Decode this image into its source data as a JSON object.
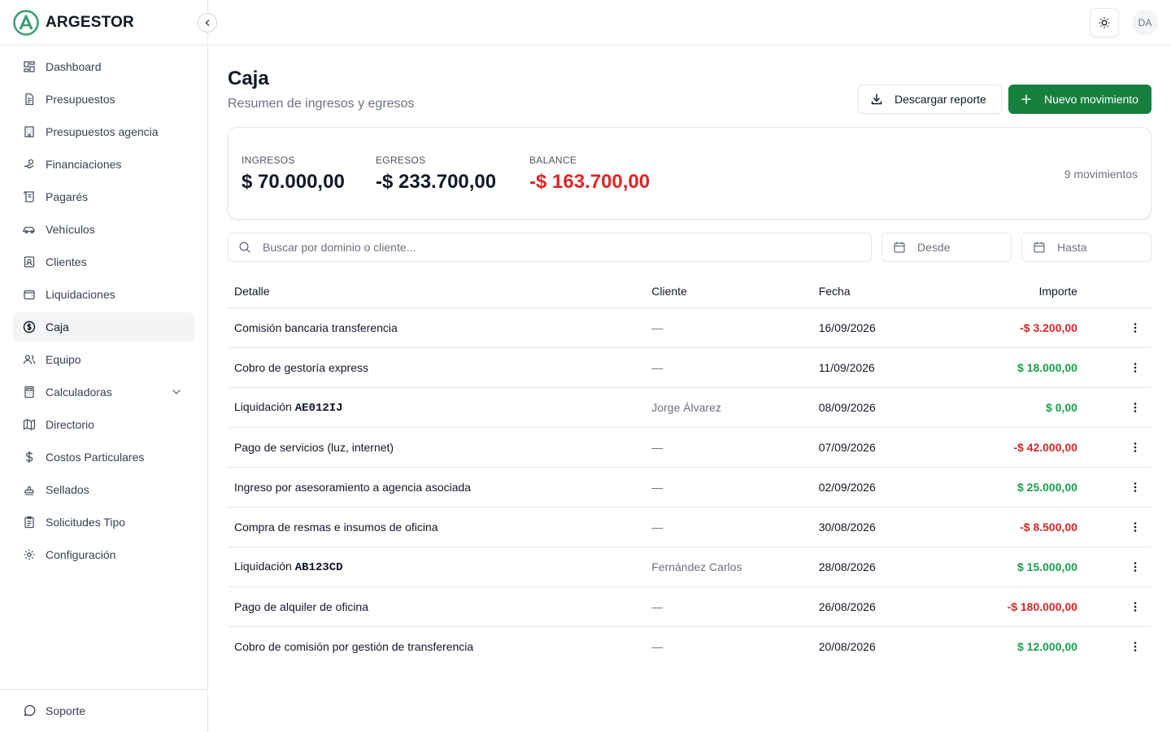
{
  "brand": {
    "name": "ARGESTOR",
    "accent": "#15803d"
  },
  "sidebar": {
    "items": [
      {
        "label": "Dashboard",
        "icon": "layout-dashboard-icon"
      },
      {
        "label": "Presupuestos",
        "icon": "file-text-icon"
      },
      {
        "label": "Presupuestos agencia",
        "icon": "building-icon"
      },
      {
        "label": "Financiaciones",
        "icon": "hand-coins-icon"
      },
      {
        "label": "Pagarés",
        "icon": "scroll-icon"
      },
      {
        "label": "Vehículos",
        "icon": "car-icon"
      },
      {
        "label": "Clientes",
        "icon": "contact-icon"
      },
      {
        "label": "Liquidaciones",
        "icon": "wallet-icon"
      },
      {
        "label": "Caja",
        "icon": "dollar-circle-icon",
        "active": true
      },
      {
        "label": "Equipo",
        "icon": "users-icon"
      },
      {
        "label": "Calculadoras",
        "icon": "calculator-icon",
        "expandable": true
      },
      {
        "label": "Directorio",
        "icon": "map-icon"
      },
      {
        "label": "Costos Particulares",
        "icon": "dollar-sign-icon"
      },
      {
        "label": "Sellados",
        "icon": "stamp-icon"
      },
      {
        "label": "Solicitudes Tipo",
        "icon": "clipboard-icon"
      },
      {
        "label": "Configuración",
        "icon": "settings-icon"
      }
    ],
    "footer_label": "Soporte"
  },
  "topbar": {
    "avatar_initials": "DA"
  },
  "page": {
    "title": "Caja",
    "subtitle": "Resumen de ingresos y egresos",
    "download_label": "Descargar reporte",
    "new_label": "Nuevo movimiento"
  },
  "summary": {
    "ingresos_label": "INGRESOS",
    "ingresos_value": "$ 70.000,00",
    "egresos_label": "EGRESOS",
    "egresos_value": "-$ 233.700,00",
    "balance_label": "BALANCE",
    "balance_value": "-$ 163.700,00",
    "count_label": "9 movimientos"
  },
  "filters": {
    "search_placeholder": "Buscar por dominio o cliente...",
    "desde_placeholder": "Desde",
    "hasta_placeholder": "Hasta"
  },
  "table": {
    "headers": {
      "detalle": "Detalle",
      "cliente": "Cliente",
      "fecha": "Fecha",
      "importe": "Importe"
    },
    "rows": [
      {
        "detalle": "Comisión bancaria transferencia",
        "dominio": "",
        "cliente": "—",
        "fecha": "16/09/2026",
        "importe": "-$ 3.200,00",
        "sign": "neg"
      },
      {
        "detalle": "Cobro de gestoría express",
        "dominio": "",
        "cliente": "—",
        "fecha": "11/09/2026",
        "importe": "$ 18.000,00",
        "sign": "pos"
      },
      {
        "detalle": "Liquidación ",
        "dominio": "AE012IJ",
        "cliente": "Jorge Álvarez",
        "fecha": "08/09/2026",
        "importe": "$ 0,00",
        "sign": "pos"
      },
      {
        "detalle": "Pago de servicios (luz, internet)",
        "dominio": "",
        "cliente": "—",
        "fecha": "07/09/2026",
        "importe": "-$ 42.000,00",
        "sign": "neg"
      },
      {
        "detalle": "Ingreso por asesoramiento a agencia asociada",
        "dominio": "",
        "cliente": "—",
        "fecha": "02/09/2026",
        "importe": "$ 25.000,00",
        "sign": "pos"
      },
      {
        "detalle": "Compra de resmas e insumos de oficina",
        "dominio": "",
        "cliente": "—",
        "fecha": "30/08/2026",
        "importe": "-$ 8.500,00",
        "sign": "neg"
      },
      {
        "detalle": "Liquidación ",
        "dominio": "AB123CD",
        "cliente": "Fernández Carlos",
        "fecha": "28/08/2026",
        "importe": "$ 15.000,00",
        "sign": "pos"
      },
      {
        "detalle": "Pago de alquiler de oficina",
        "dominio": "",
        "cliente": "—",
        "fecha": "26/08/2026",
        "importe": "-$ 180.000,00",
        "sign": "neg"
      },
      {
        "detalle": "Cobro de comisión por gestión de transferencia",
        "dominio": "",
        "cliente": "—",
        "fecha": "20/08/2026",
        "importe": "$ 12.000,00",
        "sign": "pos"
      }
    ]
  },
  "colors": {
    "positive": "#16a34a",
    "negative": "#dc2626",
    "primary": "#15803d"
  }
}
